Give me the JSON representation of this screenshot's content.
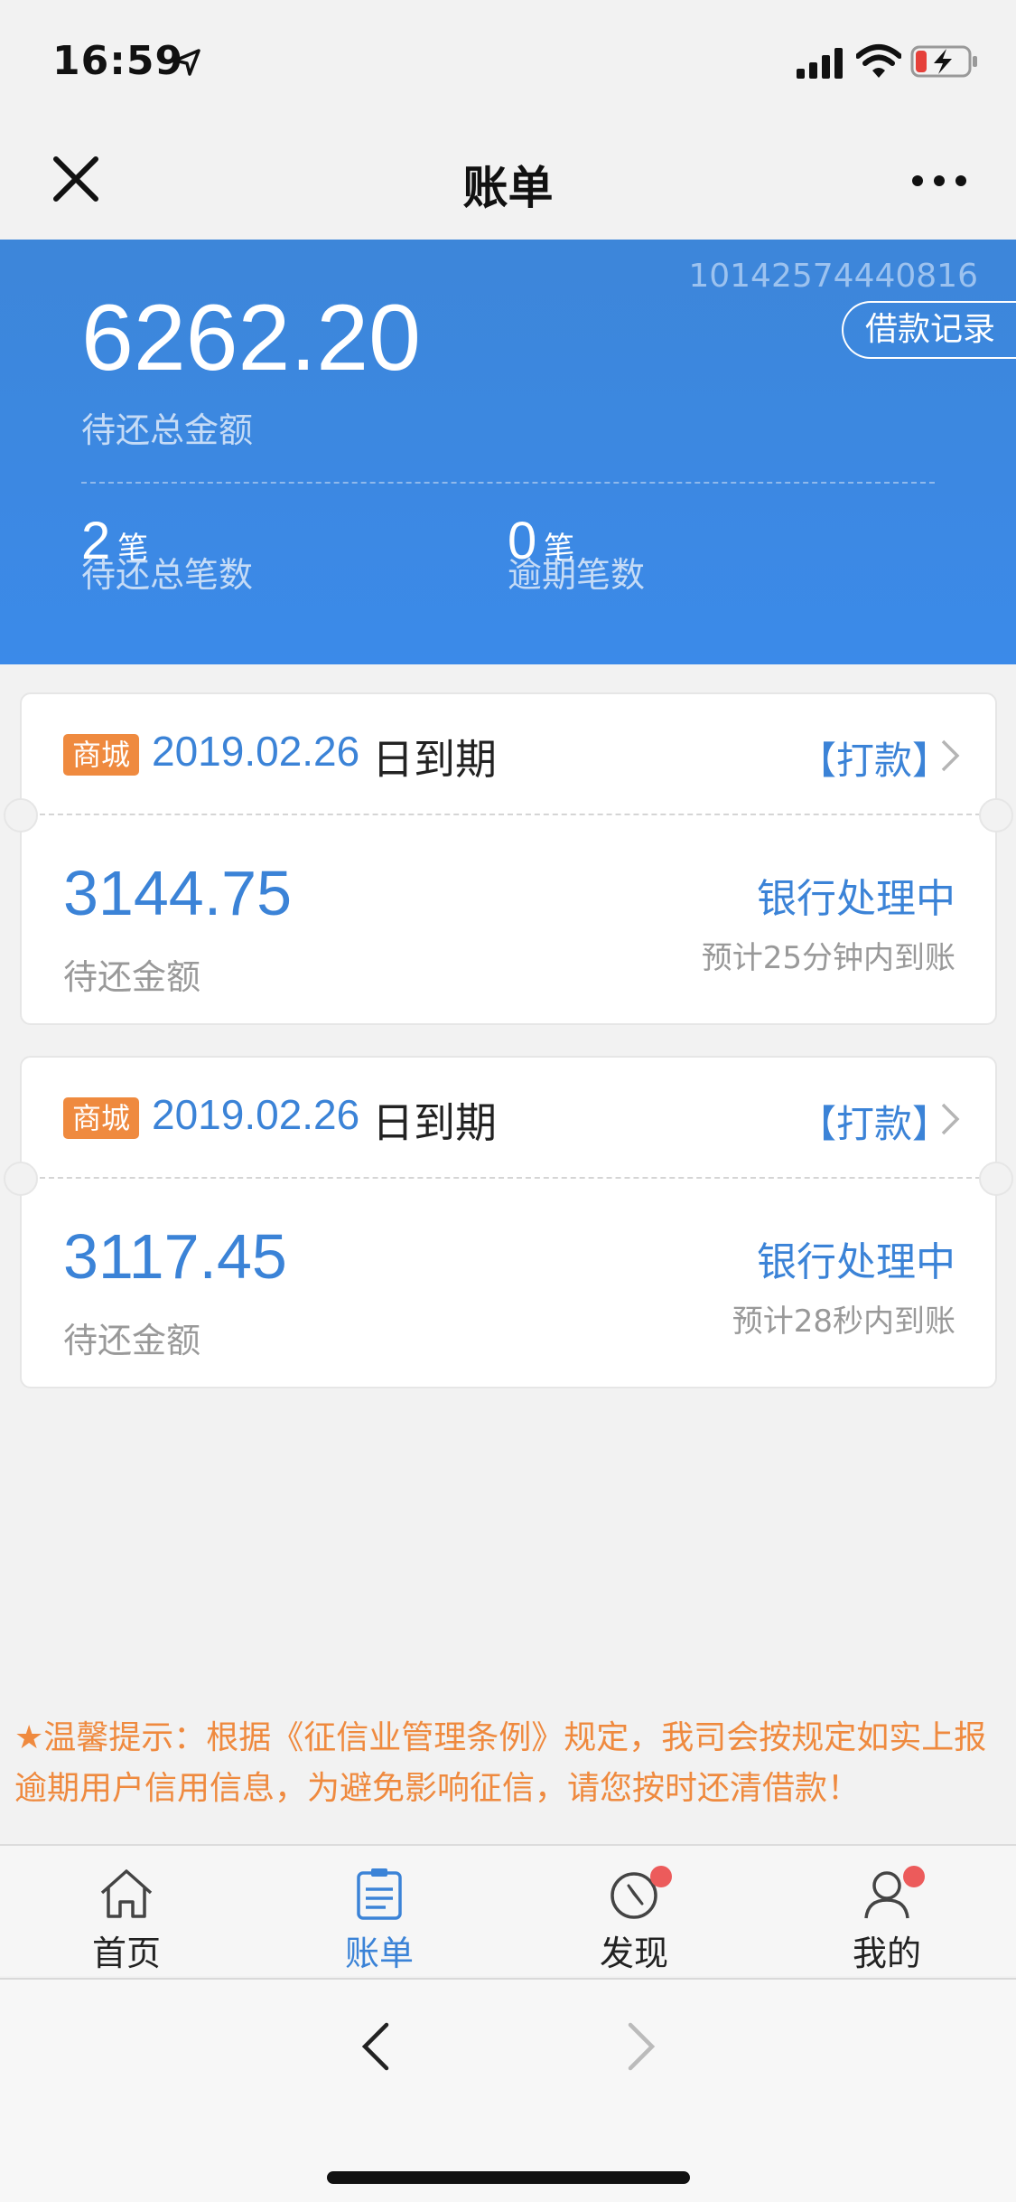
{
  "status_bar": {
    "time": "16:59"
  },
  "nav": {
    "title": "账单"
  },
  "summary": {
    "id": "10142574440816",
    "record_button": "借款记录",
    "total_amount": "6262.20",
    "total_label": "待还总金额",
    "pending_count": "2",
    "pending_unit": "笔",
    "pending_label": "待还总笔数",
    "overdue_count": "0",
    "overdue_unit": "笔",
    "overdue_label": "逾期笔数"
  },
  "bills": [
    {
      "tag": "商城",
      "due_date": "2019.02.26",
      "due_suffix": "日到期",
      "action": "【打款】",
      "amount": "3144.75",
      "amount_label": "待还金额",
      "status": "银行处理中",
      "eta": "预计25分钟内到账"
    },
    {
      "tag": "商城",
      "due_date": "2019.02.26",
      "due_suffix": "日到期",
      "action": "【打款】",
      "amount": "3117.45",
      "amount_label": "待还金额",
      "status": "银行处理中",
      "eta": "预计28秒内到账"
    }
  ],
  "warm_tip": "★温馨提示：根据《征信业管理条例》规定，我司会按规定如实上报逾期用户信用信息，为避免影响征信，请您按时还清借款！",
  "tabs": [
    {
      "label": "首页",
      "icon": "home-icon"
    },
    {
      "label": "账单",
      "icon": "bill-icon"
    },
    {
      "label": "发现",
      "icon": "compass-icon"
    },
    {
      "label": "我的",
      "icon": "user-icon"
    }
  ],
  "colors": {
    "accent": "#3b83d7",
    "tip": "#ef8a3f",
    "tag": "#ef8a3f",
    "badge": "#ec5b5b"
  }
}
